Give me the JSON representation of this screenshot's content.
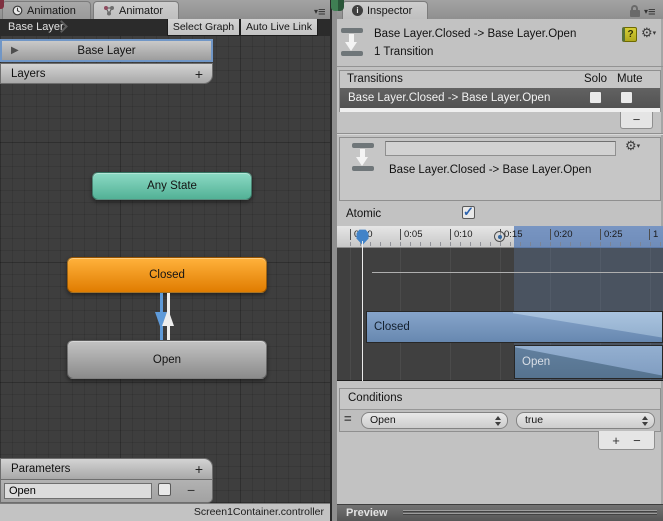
{
  "animator_panel": {
    "tabs": [
      {
        "label": "Animation",
        "active": false
      },
      {
        "label": "Animator",
        "active": true
      }
    ],
    "toolbar": {
      "breadcrumb": "Base Layer",
      "select_graph_label": "Select Graph",
      "auto_live_link_label": "Auto Live Link"
    },
    "layers_widget": {
      "selected_layer": "Base Layer",
      "header_label": "Layers",
      "add_glyph": "+"
    },
    "graph_nodes": [
      {
        "label": "Any State",
        "color": "#6FC7AE"
      },
      {
        "label": "Closed",
        "color": "#F59D18"
      },
      {
        "label": "Open",
        "color": "#A8A8A8"
      }
    ],
    "parameters_widget": {
      "header_label": "Parameters",
      "add_glyph": "+",
      "remove_glyph": "−",
      "parameter_name": "Open",
      "parameter_checked": false
    },
    "status_bar": "Screen1Container.controller"
  },
  "inspector": {
    "tab_label": "Inspector",
    "header": {
      "title": "Base Layer.Closed -> Base Layer.Open",
      "subtitle": "1 Transition"
    },
    "transitions_section": {
      "header_label": "Transitions",
      "solo_label": "Solo",
      "mute_label": "Mute",
      "rows": [
        {
          "label": "Base Layer.Closed -> Base Layer.Open",
          "solo": false,
          "mute": false,
          "selected": true
        }
      ],
      "remove_glyph": "−"
    },
    "transition_detail": {
      "name_value": "",
      "title": "Base Layer.Closed -> Base Layer.Open"
    },
    "atomic": {
      "label": "Atomic",
      "checked": true
    },
    "timeline": {
      "tick_labels": [
        "0:00",
        "0:05",
        "0:10",
        "0:15",
        "0:20",
        "0:25",
        "1"
      ],
      "tracks": [
        {
          "label": "Closed"
        },
        {
          "label": "Open"
        }
      ],
      "transition_start": "0:15"
    },
    "conditions_section": {
      "header_label": "Conditions",
      "handle_glyph": "=",
      "rows": [
        {
          "parameter": "Open",
          "value": "true"
        }
      ],
      "add_glyph": "+",
      "remove_glyph": "−"
    },
    "preview_label": "Preview"
  },
  "colors": {
    "selection_blue": "#7096C6",
    "node_any_state": "#6FC7AE",
    "node_default_orange": "#F59D18",
    "node_gray": "#A8A8A8",
    "timeline_ruler_blue": "#4E76B4",
    "transition_bar_blue": "#7899C0",
    "graph_background": "#3E3E3E",
    "inspector_background": "#C2C2C2",
    "selected_arrow_blue": "#5E9AD9"
  }
}
